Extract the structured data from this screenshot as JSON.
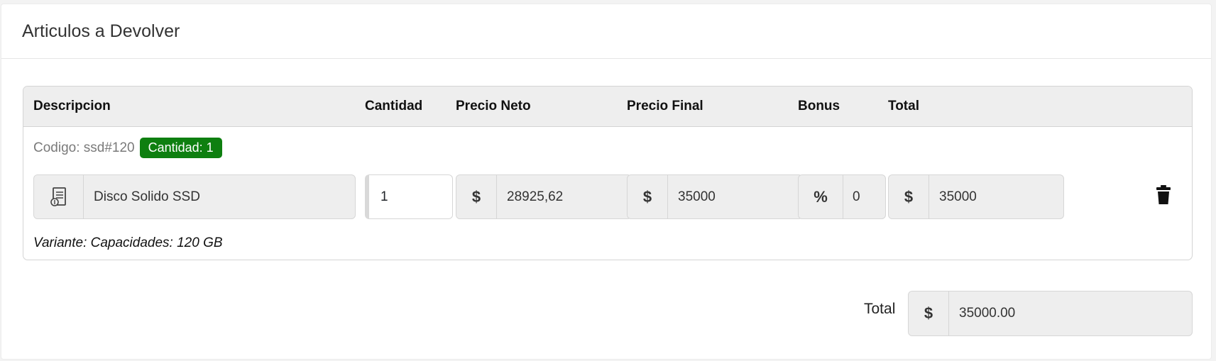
{
  "card": {
    "title": "Articulos a Devolver"
  },
  "table": {
    "headers": {
      "descripcion": "Descripcion",
      "cantidad": "Cantidad",
      "precio_neto": "Precio Neto",
      "precio_final": "Precio Final",
      "bonus": "Bonus",
      "total": "Total"
    },
    "rows": [
      {
        "codigo": "Codigo: ssd#120",
        "badge": "Cantidad: 1",
        "descripcion": "Disco Solido SSD",
        "cantidad": "1",
        "precio_neto_currency": "$",
        "precio_neto": "28925,62",
        "precio_final_currency": "$",
        "precio_final": "35000",
        "bonus_symbol": "%",
        "bonus": "0",
        "total_currency": "$",
        "total": "35000",
        "variante": "Variante: Capacidades: 120 GB",
        "icon": "receipt-icon",
        "action_icon": "trash-icon"
      }
    ]
  },
  "summary": {
    "total_label": "Total",
    "currency": "$",
    "total_value": "35000.00"
  },
  "colors": {
    "badge": "#0e7f10",
    "header_bg": "#eeeeee",
    "field_bg": "#eeeeee"
  }
}
